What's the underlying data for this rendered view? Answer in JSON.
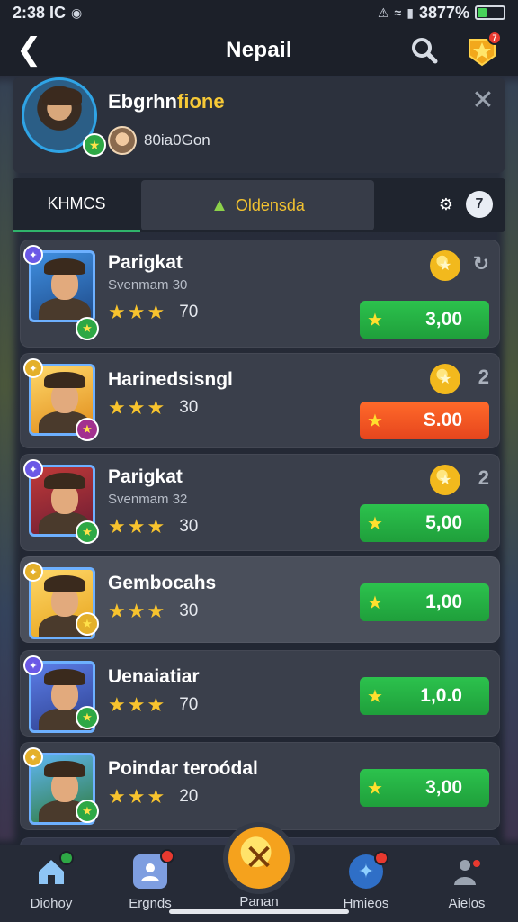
{
  "status_bar": {
    "time": "2:38 IC",
    "battery_text": "3877%",
    "battery_level": 0.35
  },
  "header": {
    "title": "Nepail",
    "back_icon": "back-arrow-icon",
    "search_icon": "search-icon",
    "badge_icon": "star-badge-icon",
    "badge_count": "7"
  },
  "profile": {
    "name_prefix": "Ebgrhn",
    "name_accent": "fione",
    "subtitle": "80ia0Gon"
  },
  "tabs": {
    "left": "KHMCS",
    "center": "Oldensda",
    "count": "7"
  },
  "rows": [
    {
      "name": "Parigkat",
      "sub": "Svenmam 30",
      "count": "70",
      "price": "3,00",
      "price_style": "green",
      "has_coin": true,
      "refresh": "↻"
    },
    {
      "name": "Harinedsisngl",
      "sub": "",
      "count": "30",
      "price": "S.00",
      "price_style": "red",
      "has_coin": true,
      "refresh": "2"
    },
    {
      "name": "Parigkat",
      "sub": "Svenmam 32",
      "count": "30",
      "price": "5,00",
      "price_style": "green",
      "has_coin": true,
      "refresh": "2"
    },
    {
      "name": "Gembocahs",
      "sub": "",
      "count": "30",
      "price": "1,00",
      "price_style": "green",
      "has_coin": false,
      "refresh": ""
    },
    {
      "name": "Uenaiatiar",
      "sub": "",
      "count": "70",
      "price": "1,0.0",
      "price_style": "green",
      "has_coin": false,
      "refresh": ""
    },
    {
      "name": "Poindar teroódal",
      "sub": "",
      "count": "20",
      "price": "3,00",
      "price_style": "green",
      "has_coin": false,
      "refresh": ""
    }
  ],
  "bottom_nav": {
    "items": [
      "Diohoy",
      "Ergnds",
      "Panan",
      "Hmieos",
      "Aielos"
    ]
  },
  "colors": {
    "accent_green": "#2cc24d",
    "accent_red": "#ff6a2a",
    "gold": "#f7c32e"
  }
}
